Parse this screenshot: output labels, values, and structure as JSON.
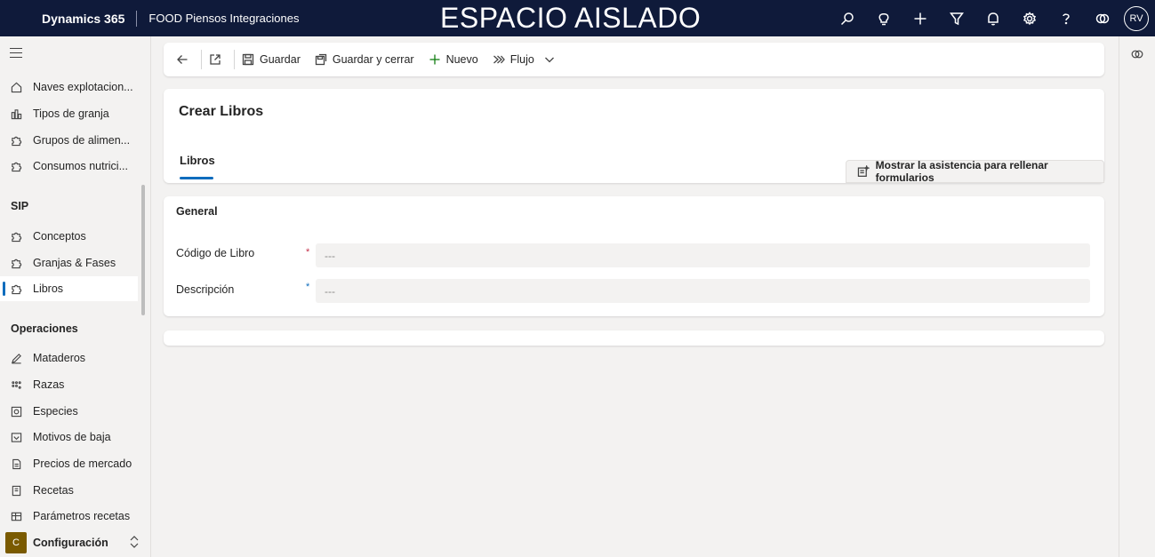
{
  "topbar": {
    "brand": "Dynamics 365",
    "app_name": "FOOD Piensos Integraciones",
    "environment_banner": "ESPACIO AISLADO",
    "icons": [
      "search-icon",
      "lightbulb-icon",
      "plus-icon",
      "filter-icon",
      "bell-icon",
      "settings-icon",
      "help-icon",
      "copilot-icon"
    ],
    "avatar_initials": "RV"
  },
  "sidebar": {
    "group1": [
      {
        "label": "Naves explotacion...",
        "icon": "home-icon"
      },
      {
        "label": "Tipos de granja",
        "icon": "chart-icon"
      },
      {
        "label": "Grupos de alimen...",
        "icon": "puzzle-icon"
      },
      {
        "label": "Consumos nutrici...",
        "icon": "puzzle-icon"
      }
    ],
    "section_sip": "SIP",
    "group_sip": [
      {
        "label": "Conceptos",
        "icon": "puzzle-icon"
      },
      {
        "label": "Granjas & Fases",
        "icon": "puzzle-icon"
      },
      {
        "label": "Libros",
        "icon": "puzzle-icon"
      }
    ],
    "section_ops": "Operaciones",
    "group_ops": [
      {
        "label": "Mataderos",
        "icon": "pen-icon"
      },
      {
        "label": "Razas",
        "icon": "dots-icon"
      },
      {
        "label": "Especies",
        "icon": "gear-grid-icon"
      },
      {
        "label": "Motivos de baja",
        "icon": "image-icon"
      },
      {
        "label": "Precios de mercado",
        "icon": "document-icon"
      },
      {
        "label": "Recetas",
        "icon": "book-icon"
      },
      {
        "label": "Parámetros recetas",
        "icon": "table-icon"
      }
    ],
    "area": {
      "badge": "C",
      "label": "Configuración"
    }
  },
  "commandbar": {
    "save": "Guardar",
    "save_close": "Guardar y cerrar",
    "new": "Nuevo",
    "flow": "Flujo"
  },
  "form": {
    "title": "Crear Libros",
    "tab": "Libros",
    "assist_button": "Mostrar la asistencia para rellenar formularios",
    "section_title": "General",
    "fields": [
      {
        "label": "Código de Libro",
        "required_marker": "*",
        "value": "---"
      },
      {
        "label": "Descripción",
        "required_marker": "*",
        "value": "---"
      }
    ]
  },
  "colors": {
    "topbar_bg": "#0f1a3a",
    "accent": "#0f6cbd",
    "required": "#c4314b",
    "area_badge": "#7a5a00"
  }
}
